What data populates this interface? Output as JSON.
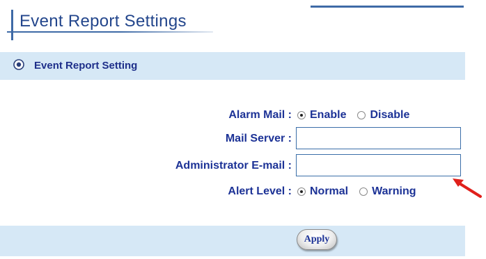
{
  "page": {
    "title": "Event Report Settings"
  },
  "section": {
    "title": "Event Report Setting",
    "icon": "circle-bullet-icon"
  },
  "form": {
    "alarm_mail": {
      "label": "Alarm Mail :",
      "options": [
        {
          "label": "Enable",
          "checked": true
        },
        {
          "label": "Disable",
          "checked": false
        }
      ]
    },
    "mail_server": {
      "label": "Mail Server :",
      "value": ""
    },
    "admin_email": {
      "label": "Administrator E-mail :",
      "value": ""
    },
    "alert_level": {
      "label": "Alert Level :",
      "options": [
        {
          "label": "Normal",
          "checked": true
        },
        {
          "label": "Warning",
          "checked": false
        }
      ]
    }
  },
  "footer": {
    "apply_label": "Apply"
  },
  "colors": {
    "accent": "#23468c",
    "label": "#1c3296",
    "header_bg": "#d6e8f6",
    "annotation_arrow": "#e0201b"
  }
}
